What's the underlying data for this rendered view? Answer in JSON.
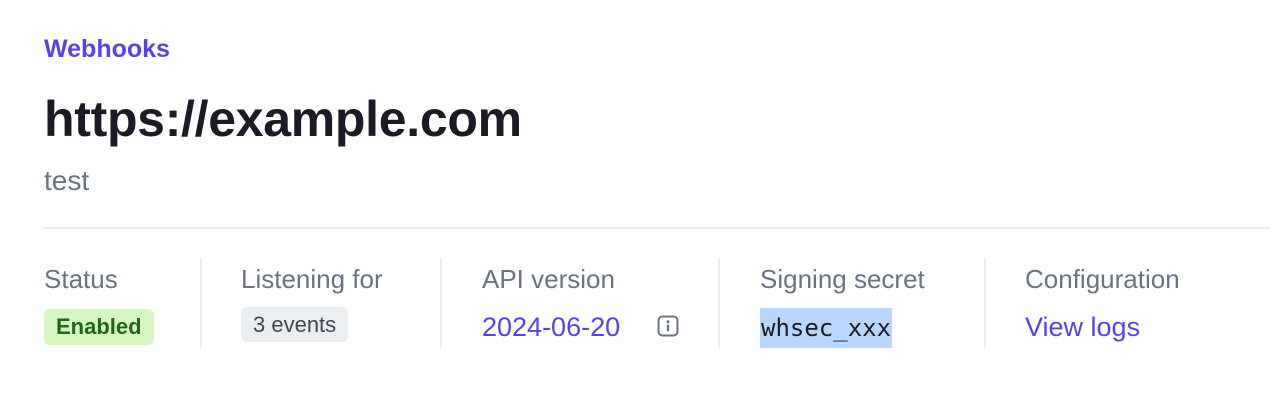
{
  "breadcrumb": {
    "label": "Webhooks"
  },
  "header": {
    "title": "https://example.com",
    "description": "test"
  },
  "details": {
    "status": {
      "label": "Status",
      "value": "Enabled"
    },
    "listening": {
      "label": "Listening for",
      "value": "3 events"
    },
    "api_version": {
      "label": "API version",
      "value": "2024-06-20",
      "icon": "info-icon"
    },
    "signing_secret": {
      "label": "Signing secret",
      "value": "whsec_xxx"
    },
    "configuration": {
      "label": "Configuration",
      "link": "View logs"
    }
  },
  "colors": {
    "accent": "#5b3ff0",
    "status_enabled_bg": "#d7f7c2",
    "status_enabled_text": "#1d6a12",
    "selection_highlight": "#b8d7ff"
  }
}
